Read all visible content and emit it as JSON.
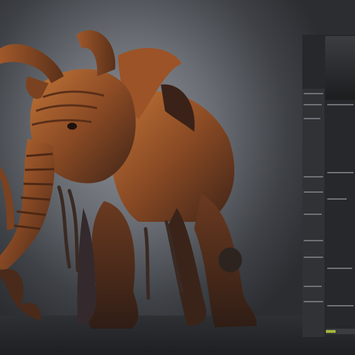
{
  "image": {
    "subject": "creature-render",
    "colors": {
      "skin": "#8a4a24",
      "skin_dark": "#3f2418",
      "highlight": "#c97a3e",
      "background": "#7d8187",
      "panel": "#26282b",
      "status_ok": "#a6b63a"
    }
  },
  "panel": {
    "icons": [
      "panel-thumbnail",
      "status-indicator"
    ]
  }
}
